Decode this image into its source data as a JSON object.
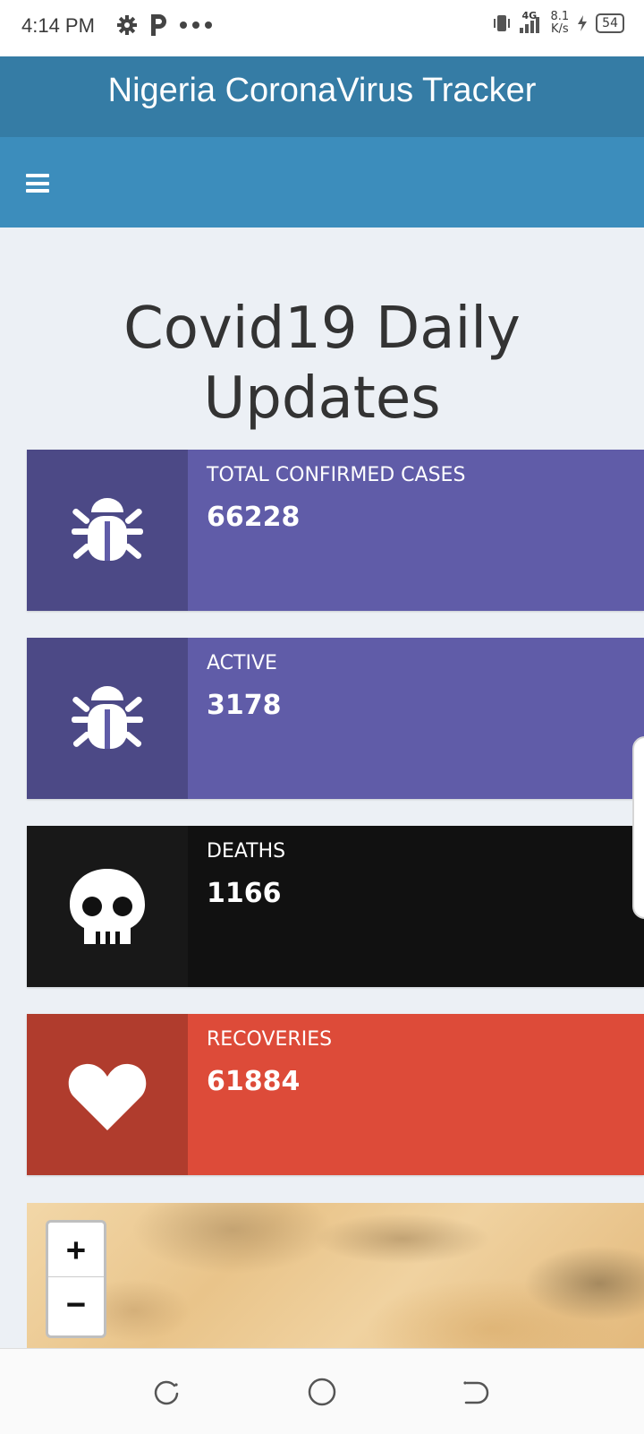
{
  "status_bar": {
    "time": "4:14 PM",
    "icons_left": [
      "gear-icon",
      "p-app-icon",
      "more-dots-icon"
    ],
    "network_type": "4G",
    "net_speed_value": "8.1",
    "net_speed_unit": "K/s",
    "battery_level": "54"
  },
  "app": {
    "title": "Nigeria CoronaVirus Tracker",
    "menu_icon": "hamburger-icon"
  },
  "page": {
    "heading": "Covid19 Daily Updates"
  },
  "stats": [
    {
      "label": "TOTAL CONFIRMED CASES",
      "value": "66228",
      "icon": "bug-icon",
      "color": "#605ca8"
    },
    {
      "label": "ACTIVE",
      "value": "3178",
      "icon": "bug-icon",
      "color": "#605ca8"
    },
    {
      "label": "DEATHS",
      "value": "1166",
      "icon": "skull-icon",
      "color": "#111111"
    },
    {
      "label": "RECOVERIES",
      "value": "61884",
      "icon": "heart-icon",
      "color": "#dd4b39"
    }
  ],
  "map": {
    "zoom_in": "+",
    "zoom_out": "−"
  },
  "system_nav": [
    "recent-apps-icon",
    "home-icon",
    "back-icon"
  ]
}
